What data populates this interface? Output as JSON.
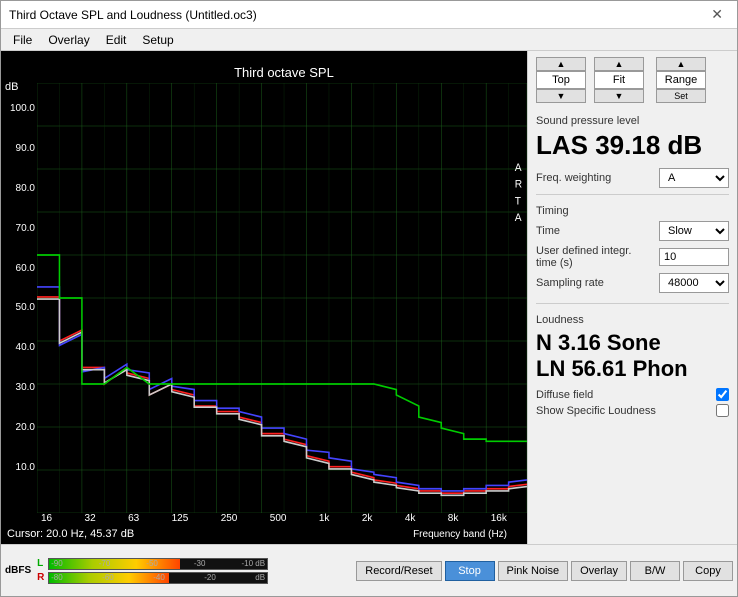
{
  "window": {
    "title": "Third Octave SPL and Loudness (Untitled.oc3)",
    "close_label": "✕"
  },
  "menu": {
    "items": [
      "File",
      "Overlay",
      "Edit",
      "Setup"
    ]
  },
  "chart": {
    "title": "Third octave SPL",
    "db_label": "dB",
    "arta_label": "A\nR\nT\nA",
    "y_axis": [
      "100.0",
      "90.0",
      "80.0",
      "70.0",
      "60.0",
      "50.0",
      "40.0",
      "30.0",
      "20.0",
      "10.0"
    ],
    "x_axis": [
      "16",
      "32",
      "63",
      "125",
      "250",
      "500",
      "1k",
      "2k",
      "4k",
      "8k",
      "16k"
    ],
    "x_axis_title": "Frequency band (Hz)",
    "cursor_info": "Cursor:  20.0 Hz, 45.37 dB"
  },
  "right_panel": {
    "top_button_top": "Top",
    "top_button_fit": "Fit",
    "top_button_range": "Range",
    "top_button_set": "Set",
    "spl_section_label": "Sound pressure level",
    "spl_value": "LAS 39.18 dB",
    "freq_weighting_label": "Freq. weighting",
    "freq_weighting_value": "A",
    "timing_section_label": "Timing",
    "time_label": "Time",
    "time_value": "Slow",
    "user_defined_label": "User defined integr. time (s)",
    "user_defined_value": "10",
    "sampling_rate_label": "Sampling rate",
    "sampling_rate_value": "48000",
    "loudness_section_label": "Loudness",
    "loudness_n": "N 3.16 Sone",
    "loudness_ln": "LN 56.61 Phon",
    "diffuse_field_label": "Diffuse field",
    "show_specific_label": "Show Specific Loudness",
    "diffuse_checked": true,
    "show_specific_checked": false
  },
  "bottom": {
    "dbfs_label": "dBFS",
    "level_bar_L": "L",
    "level_bar_R": "R",
    "ticks_top": [
      "-90",
      "-70",
      "-50",
      "-30",
      "-10 dB"
    ],
    "ticks_bottom": [
      "-80",
      "-60",
      "-40",
      "-20",
      "dB"
    ],
    "buttons": [
      "Record/Reset",
      "Stop",
      "Pink Noise",
      "Overlay",
      "B/W",
      "Copy"
    ],
    "active_button": "Stop"
  }
}
